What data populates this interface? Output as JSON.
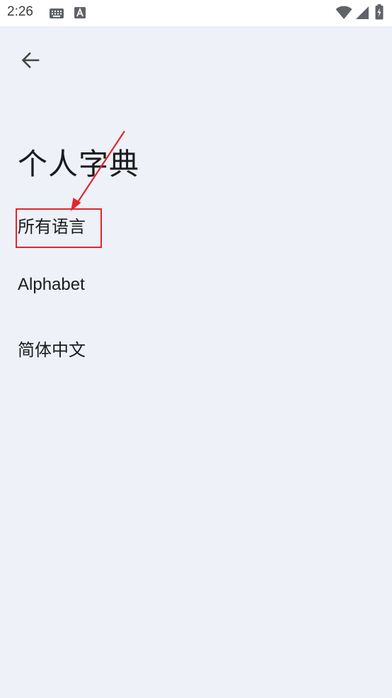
{
  "status_bar": {
    "time": "2:26",
    "icons": [
      "keyboard-icon",
      "text-a-icon",
      "wifi-icon",
      "signal-icon",
      "battery-icon"
    ]
  },
  "toolbar": {
    "back_icon": "arrow-left-icon"
  },
  "page": {
    "title": "个人字典"
  },
  "languages": [
    {
      "label": "所有语言"
    },
    {
      "label": "Alphabet"
    },
    {
      "label": "简体中文"
    }
  ],
  "annotation": {
    "color": "#e0262e"
  }
}
